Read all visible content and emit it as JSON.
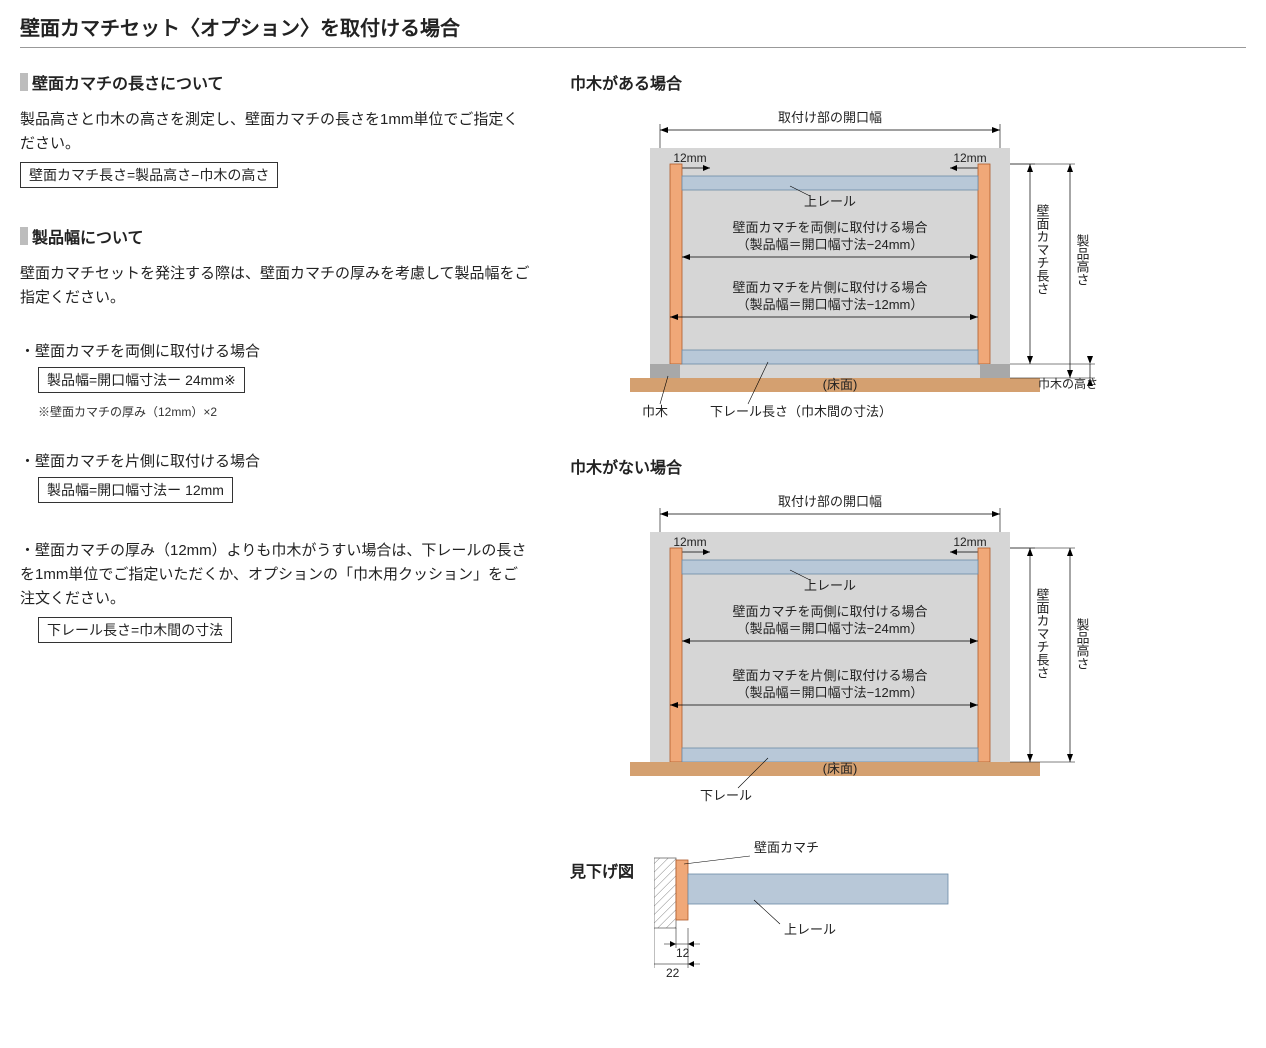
{
  "title": "壁面カマチセット〈オプション〉を取付ける場合",
  "left": {
    "sec1": {
      "heading": "壁面カマチの長さについて",
      "para": "製品高さと巾木の高さを測定し、壁面カマチの長さを1mm単位でご指定ください。",
      "formula": "壁面カマチ長さ=製品高さ−巾木の高さ"
    },
    "sec2": {
      "heading": "製品幅について",
      "para": "壁面カマチセットを発注する際は、壁面カマチの厚みを考慮して製品幅をご指定ください。",
      "item1": {
        "label": "・壁面カマチを両側に取付ける場合",
        "formula": "製品幅=開口幅寸法ー 24mm※",
        "note": "※壁面カマチの厚み（12mm）×2"
      },
      "item2": {
        "label": "・壁面カマチを片側に取付ける場合",
        "formula": "製品幅=開口幅寸法ー 12mm"
      },
      "item3": {
        "para": "・壁面カマチの厚み（12mm）よりも巾木がうすい場合は、下レールの長さを1mm単位でご指定いただくか、オプションの「巾木用クッション」をご注文ください。",
        "formula": "下レール長さ=巾木間の寸法"
      }
    }
  },
  "right": {
    "case1": {
      "title": "巾木がある場合",
      "opening_width": "取付け部の開口幅",
      "mm12_left": "12mm",
      "mm12_right": "12mm",
      "top_rail": "上レール",
      "both_line1": "壁面カマチを両側に取付ける場合",
      "both_line2": "（製品幅＝開口幅寸法−24mm）",
      "one_line1": "壁面カマチを片側に取付ける場合",
      "one_line2": "（製品幅＝開口幅寸法−12mm）",
      "kamachi_len": "壁面カマチ長さ",
      "product_h": "製品高さ",
      "floor": "(床面)",
      "baseboard": "巾木",
      "bottom_rail": "下レール長さ（巾木間の寸法）",
      "baseboard_h": "巾木の高さ"
    },
    "case2": {
      "title": "巾木がない場合",
      "opening_width": "取付け部の開口幅",
      "mm12_left": "12mm",
      "mm12_right": "12mm",
      "top_rail": "上レール",
      "both_line1": "壁面カマチを両側に取付ける場合",
      "both_line2": "（製品幅＝開口幅寸法−24mm）",
      "one_line1": "壁面カマチを片側に取付ける場合",
      "one_line2": "（製品幅＝開口幅寸法−12mm）",
      "kamachi_len": "壁面カマチ長さ",
      "product_h": "製品高さ",
      "floor": "(床面)",
      "bottom_rail": "下レール"
    },
    "topview": {
      "title": "見下げ図",
      "kamachi": "壁面カマチ",
      "top_rail": "上レール",
      "d12": "12",
      "d22": "22"
    }
  }
}
